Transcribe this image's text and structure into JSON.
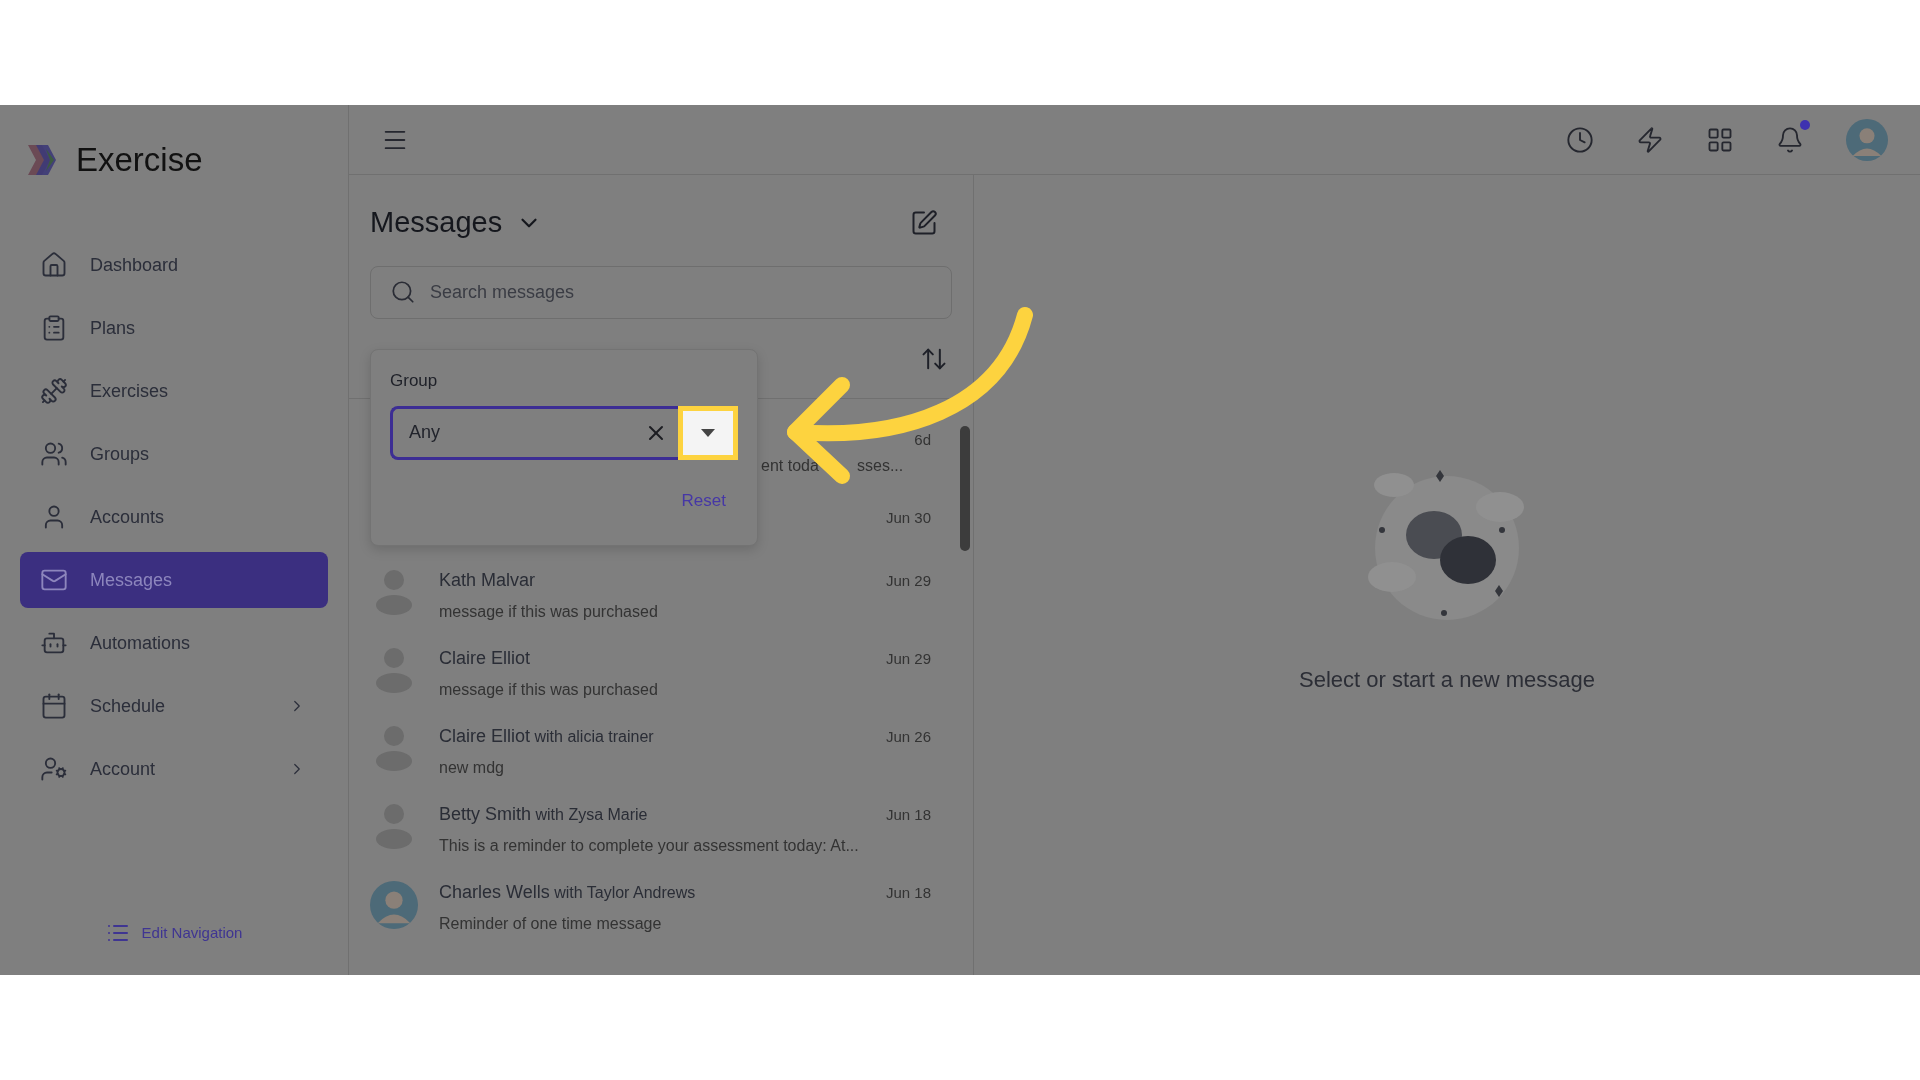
{
  "sidebar": {
    "logo_text": "Exercise",
    "items": [
      {
        "label": "Dashboard",
        "selected": false,
        "expandable": false
      },
      {
        "label": "Plans",
        "selected": false,
        "expandable": false
      },
      {
        "label": "Exercises",
        "selected": false,
        "expandable": false
      },
      {
        "label": "Groups",
        "selected": false,
        "expandable": false
      },
      {
        "label": "Accounts",
        "selected": false,
        "expandable": false
      },
      {
        "label": "Messages",
        "selected": true,
        "expandable": false
      },
      {
        "label": "Automations",
        "selected": false,
        "expandable": false
      },
      {
        "label": "Schedule",
        "selected": false,
        "expandable": true
      },
      {
        "label": "Account",
        "selected": false,
        "expandable": true
      }
    ],
    "edit_navigation": "Edit Navigation"
  },
  "topbar": {
    "has_notification": true
  },
  "messages": {
    "title": "Messages",
    "search": {
      "placeholder": "Search messages"
    },
    "rows": [
      {
        "kind": "covered",
        "preview_fragments": [
          "ent toda",
          "sses..."
        ],
        "date": "6d"
      },
      {
        "kind": "covered",
        "date": "Jun 30"
      },
      {
        "kind": "silhouette",
        "name": "Kath Malvar",
        "preview": "message if this was purchased",
        "date": "Jun 29"
      },
      {
        "kind": "silhouette",
        "name": "Claire Elliot",
        "preview": "message if this was purchased",
        "date": "Jun 29"
      },
      {
        "kind": "silhouette",
        "name": "Claire Elliot",
        "participants": "with alicia trainer",
        "preview": "new mdg",
        "date": "Jun 26"
      },
      {
        "kind": "silhouette",
        "name": "Betty Smith",
        "participants": "with Zysa Marie",
        "preview": "This is a reminder to complete your assessment today: At...",
        "date": "Jun 18"
      },
      {
        "kind": "photo",
        "name": "Charles Wells",
        "participants": "with Taylor Andrews",
        "preview": "Reminder of one time message",
        "date": "Jun 18"
      }
    ]
  },
  "filter_popup": {
    "label": "Group",
    "value": "Any",
    "reset": "Reset"
  },
  "empty_state": {
    "text": "Select or start a new message"
  }
}
